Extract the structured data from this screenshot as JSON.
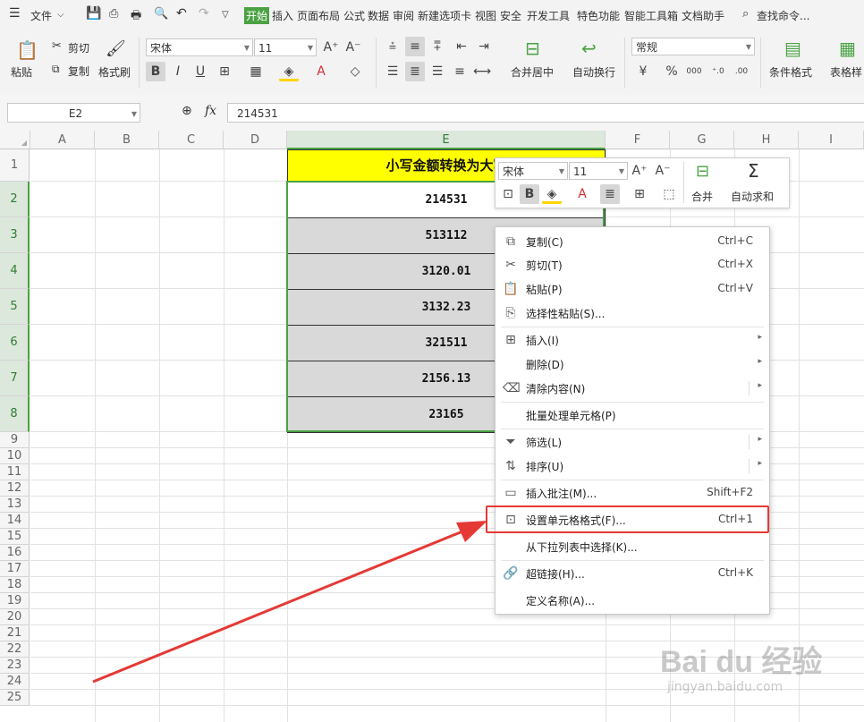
{
  "menubar": {
    "file_label": "文件",
    "tabs": [
      "开始",
      "插入",
      "页面布局",
      "公式",
      "数据",
      "审阅",
      "新建选项卡",
      "视图",
      "安全",
      "开发工具",
      "特色功能",
      "智能工具箱",
      "文档助手"
    ],
    "search_label": "查找命令..."
  },
  "ribbon": {
    "paste": "粘贴",
    "cut": "剪切",
    "copy": "复制",
    "format_painter": "格式刷",
    "font_name": "宋体",
    "font_size": "11",
    "merge_center": "合并居中",
    "wrap_text": "自动换行",
    "number_format": "常规",
    "conditional_format": "条件格式",
    "table_style": "表格样"
  },
  "formula_bar": {
    "name_box": "E2",
    "fx": "fx",
    "value": "214531"
  },
  "sheet": {
    "columns": [
      "A",
      "B",
      "C",
      "D",
      "E",
      "F",
      "G",
      "H",
      "I"
    ],
    "rows": [
      "1",
      "2",
      "3",
      "4",
      "5",
      "6",
      "7",
      "8",
      "9",
      "10",
      "11",
      "12",
      "13",
      "14",
      "15",
      "16",
      "17",
      "18",
      "19",
      "20",
      "21",
      "22",
      "23",
      "24",
      "25"
    ],
    "header_cell": "小写金额转换为大写",
    "values": [
      "214531",
      "513112",
      "3120.01",
      "3132.23",
      "321511",
      "2156.13",
      "23165"
    ]
  },
  "mini_toolbar": {
    "font_name": "宋体",
    "font_size": "11",
    "merge": "合并",
    "autosum": "自动求和"
  },
  "context_menu": {
    "items": [
      {
        "label": "复制(C)",
        "shortcut": "Ctrl+C"
      },
      {
        "label": "剪切(T)",
        "shortcut": "Ctrl+X"
      },
      {
        "label": "粘贴(P)",
        "shortcut": "Ctrl+V"
      },
      {
        "label": "选择性粘贴(S)...",
        "shortcut": ""
      },
      {
        "label": "插入(I)",
        "shortcut": ""
      },
      {
        "label": "删除(D)",
        "shortcut": ""
      },
      {
        "label": "清除内容(N)",
        "shortcut": ""
      },
      {
        "label": "批量处理单元格(P)",
        "shortcut": ""
      },
      {
        "label": "筛选(L)",
        "shortcut": ""
      },
      {
        "label": "排序(U)",
        "shortcut": ""
      },
      {
        "label": "插入批注(M)...",
        "shortcut": "Shift+F2"
      },
      {
        "label": "设置单元格格式(F)...",
        "shortcut": "Ctrl+1"
      },
      {
        "label": "从下拉列表中选择(K)...",
        "shortcut": ""
      },
      {
        "label": "超链接(H)...",
        "shortcut": "Ctrl+K"
      },
      {
        "label": "定义名称(A)...",
        "shortcut": ""
      }
    ]
  },
  "watermark": {
    "brand": "Bai du 经验",
    "url": "jingyan.baidu.com"
  },
  "colors": {
    "accent_green": "#4aa243",
    "header_fill": "#ffff00",
    "selected_fill": "#d9d9d9",
    "highlight_red": "#e53935"
  }
}
